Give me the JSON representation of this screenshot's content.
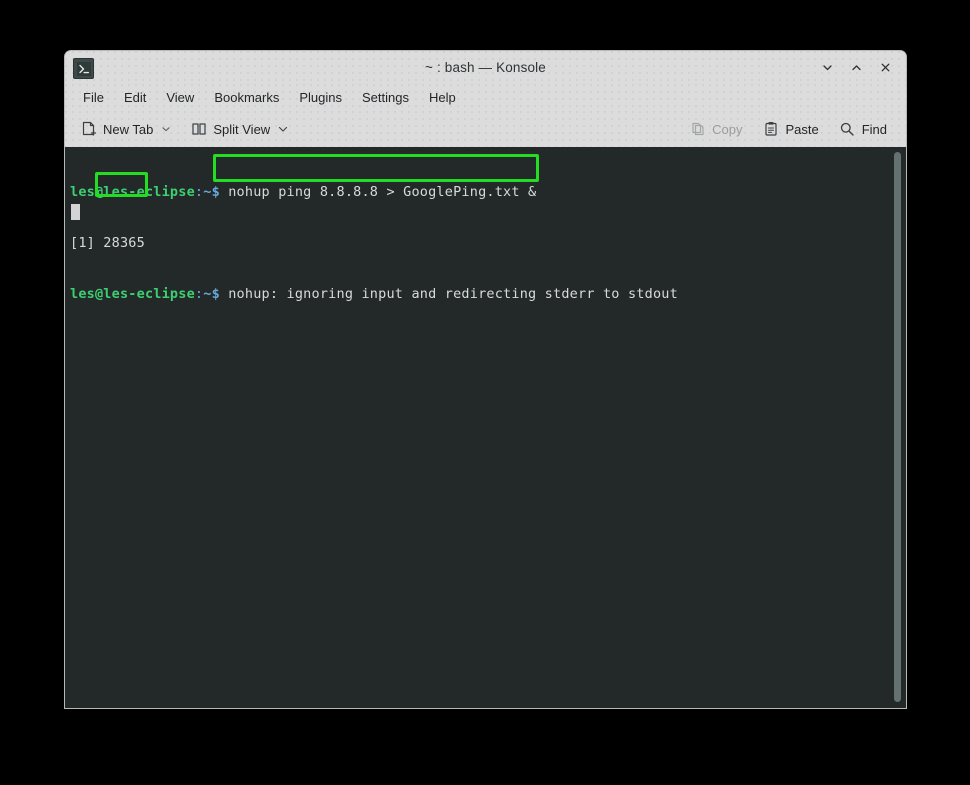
{
  "window": {
    "title": "~ : bash — Konsole",
    "app_icon": "terminal-icon",
    "buttons": [
      {
        "name": "minimize",
        "icon": "chevron-down-icon"
      },
      {
        "name": "maximize",
        "icon": "chevron-up-icon"
      },
      {
        "name": "close",
        "icon": "close-icon"
      }
    ]
  },
  "menubar": {
    "items": [
      {
        "label": "File"
      },
      {
        "label": "Edit"
      },
      {
        "label": "View"
      },
      {
        "label": "Bookmarks"
      },
      {
        "label": "Plugins"
      },
      {
        "label": "Settings"
      },
      {
        "label": "Help"
      }
    ]
  },
  "toolbar": {
    "left": [
      {
        "label": "New Tab",
        "icon": "new-tab-icon",
        "has_caret": true,
        "disabled": false
      },
      {
        "label": "Split View",
        "icon": "split-view-icon",
        "has_caret": true,
        "disabled": false
      }
    ],
    "right": [
      {
        "label": "Copy",
        "icon": "copy-icon",
        "has_caret": false,
        "disabled": true
      },
      {
        "label": "Paste",
        "icon": "paste-icon",
        "has_caret": false,
        "disabled": false
      },
      {
        "label": "Find",
        "icon": "search-icon",
        "has_caret": false,
        "disabled": false
      }
    ]
  },
  "terminal": {
    "prompt_user": "les@les-eclipse",
    "prompt_colon": ":",
    "prompt_path": "~$",
    "line1_command": " nohup ping 8.8.8.8 > GooglePing.txt &",
    "line2": "[1] 28365",
    "line3_output": " nohup: ignoring input and redirecting stderr to stdout",
    "cursor": "block-cursor",
    "colors": {
      "background": "#232829",
      "foreground": "#d7dadb",
      "prompt_user": "#3cd070",
      "prompt_path": "#6aa8d8"
    }
  },
  "annotations": {
    "highlight_color": "#22dd22",
    "boxes": [
      {
        "name": "command-highlight",
        "target": "nohup ping 8.8.8.8 > GooglePing.txt &"
      },
      {
        "name": "pid-highlight",
        "target": "28365"
      }
    ]
  }
}
